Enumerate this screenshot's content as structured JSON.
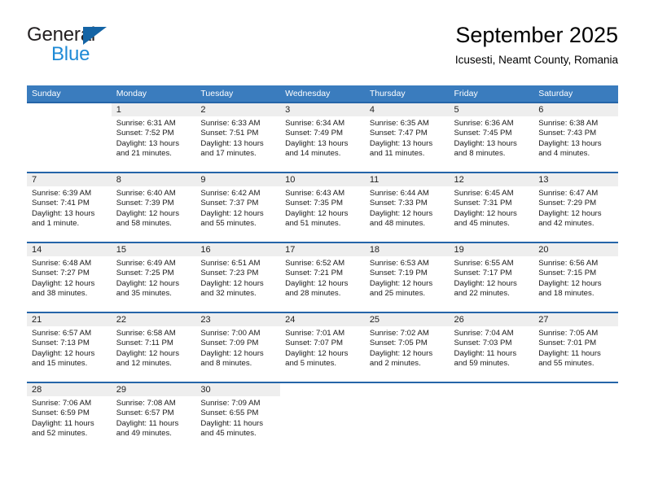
{
  "brand": {
    "line1": "General",
    "line2": "Blue",
    "colors": {
      "dark": "#231f20",
      "blue": "#1e8ad6",
      "triangle": "#1464a5"
    }
  },
  "header": {
    "month_title": "September 2025",
    "location": "Icusesti, Neamt County, Romania"
  },
  "calendar": {
    "header_bg": "#3a7cbe",
    "row_border": "#2565a8",
    "daynum_bg": "#eeeeee",
    "weekdays": [
      "Sunday",
      "Monday",
      "Tuesday",
      "Wednesday",
      "Thursday",
      "Friday",
      "Saturday"
    ],
    "weeks": [
      [
        {
          "day": "",
          "sunrise": "",
          "sunset": "",
          "daylight": "",
          "daylight2": ""
        },
        {
          "day": "1",
          "sunrise": "Sunrise: 6:31 AM",
          "sunset": "Sunset: 7:52 PM",
          "daylight": "Daylight: 13 hours",
          "daylight2": "and 21 minutes."
        },
        {
          "day": "2",
          "sunrise": "Sunrise: 6:33 AM",
          "sunset": "Sunset: 7:51 PM",
          "daylight": "Daylight: 13 hours",
          "daylight2": "and 17 minutes."
        },
        {
          "day": "3",
          "sunrise": "Sunrise: 6:34 AM",
          "sunset": "Sunset: 7:49 PM",
          "daylight": "Daylight: 13 hours",
          "daylight2": "and 14 minutes."
        },
        {
          "day": "4",
          "sunrise": "Sunrise: 6:35 AM",
          "sunset": "Sunset: 7:47 PM",
          "daylight": "Daylight: 13 hours",
          "daylight2": "and 11 minutes."
        },
        {
          "day": "5",
          "sunrise": "Sunrise: 6:36 AM",
          "sunset": "Sunset: 7:45 PM",
          "daylight": "Daylight: 13 hours",
          "daylight2": "and 8 minutes."
        },
        {
          "day": "6",
          "sunrise": "Sunrise: 6:38 AM",
          "sunset": "Sunset: 7:43 PM",
          "daylight": "Daylight: 13 hours",
          "daylight2": "and 4 minutes."
        }
      ],
      [
        {
          "day": "7",
          "sunrise": "Sunrise: 6:39 AM",
          "sunset": "Sunset: 7:41 PM",
          "daylight": "Daylight: 13 hours",
          "daylight2": "and 1 minute."
        },
        {
          "day": "8",
          "sunrise": "Sunrise: 6:40 AM",
          "sunset": "Sunset: 7:39 PM",
          "daylight": "Daylight: 12 hours",
          "daylight2": "and 58 minutes."
        },
        {
          "day": "9",
          "sunrise": "Sunrise: 6:42 AM",
          "sunset": "Sunset: 7:37 PM",
          "daylight": "Daylight: 12 hours",
          "daylight2": "and 55 minutes."
        },
        {
          "day": "10",
          "sunrise": "Sunrise: 6:43 AM",
          "sunset": "Sunset: 7:35 PM",
          "daylight": "Daylight: 12 hours",
          "daylight2": "and 51 minutes."
        },
        {
          "day": "11",
          "sunrise": "Sunrise: 6:44 AM",
          "sunset": "Sunset: 7:33 PM",
          "daylight": "Daylight: 12 hours",
          "daylight2": "and 48 minutes."
        },
        {
          "day": "12",
          "sunrise": "Sunrise: 6:45 AM",
          "sunset": "Sunset: 7:31 PM",
          "daylight": "Daylight: 12 hours",
          "daylight2": "and 45 minutes."
        },
        {
          "day": "13",
          "sunrise": "Sunrise: 6:47 AM",
          "sunset": "Sunset: 7:29 PM",
          "daylight": "Daylight: 12 hours",
          "daylight2": "and 42 minutes."
        }
      ],
      [
        {
          "day": "14",
          "sunrise": "Sunrise: 6:48 AM",
          "sunset": "Sunset: 7:27 PM",
          "daylight": "Daylight: 12 hours",
          "daylight2": "and 38 minutes."
        },
        {
          "day": "15",
          "sunrise": "Sunrise: 6:49 AM",
          "sunset": "Sunset: 7:25 PM",
          "daylight": "Daylight: 12 hours",
          "daylight2": "and 35 minutes."
        },
        {
          "day": "16",
          "sunrise": "Sunrise: 6:51 AM",
          "sunset": "Sunset: 7:23 PM",
          "daylight": "Daylight: 12 hours",
          "daylight2": "and 32 minutes."
        },
        {
          "day": "17",
          "sunrise": "Sunrise: 6:52 AM",
          "sunset": "Sunset: 7:21 PM",
          "daylight": "Daylight: 12 hours",
          "daylight2": "and 28 minutes."
        },
        {
          "day": "18",
          "sunrise": "Sunrise: 6:53 AM",
          "sunset": "Sunset: 7:19 PM",
          "daylight": "Daylight: 12 hours",
          "daylight2": "and 25 minutes."
        },
        {
          "day": "19",
          "sunrise": "Sunrise: 6:55 AM",
          "sunset": "Sunset: 7:17 PM",
          "daylight": "Daylight: 12 hours",
          "daylight2": "and 22 minutes."
        },
        {
          "day": "20",
          "sunrise": "Sunrise: 6:56 AM",
          "sunset": "Sunset: 7:15 PM",
          "daylight": "Daylight: 12 hours",
          "daylight2": "and 18 minutes."
        }
      ],
      [
        {
          "day": "21",
          "sunrise": "Sunrise: 6:57 AM",
          "sunset": "Sunset: 7:13 PM",
          "daylight": "Daylight: 12 hours",
          "daylight2": "and 15 minutes."
        },
        {
          "day": "22",
          "sunrise": "Sunrise: 6:58 AM",
          "sunset": "Sunset: 7:11 PM",
          "daylight": "Daylight: 12 hours",
          "daylight2": "and 12 minutes."
        },
        {
          "day": "23",
          "sunrise": "Sunrise: 7:00 AM",
          "sunset": "Sunset: 7:09 PM",
          "daylight": "Daylight: 12 hours",
          "daylight2": "and 8 minutes."
        },
        {
          "day": "24",
          "sunrise": "Sunrise: 7:01 AM",
          "sunset": "Sunset: 7:07 PM",
          "daylight": "Daylight: 12 hours",
          "daylight2": "and 5 minutes."
        },
        {
          "day": "25",
          "sunrise": "Sunrise: 7:02 AM",
          "sunset": "Sunset: 7:05 PM",
          "daylight": "Daylight: 12 hours",
          "daylight2": "and 2 minutes."
        },
        {
          "day": "26",
          "sunrise": "Sunrise: 7:04 AM",
          "sunset": "Sunset: 7:03 PM",
          "daylight": "Daylight: 11 hours",
          "daylight2": "and 59 minutes."
        },
        {
          "day": "27",
          "sunrise": "Sunrise: 7:05 AM",
          "sunset": "Sunset: 7:01 PM",
          "daylight": "Daylight: 11 hours",
          "daylight2": "and 55 minutes."
        }
      ],
      [
        {
          "day": "28",
          "sunrise": "Sunrise: 7:06 AM",
          "sunset": "Sunset: 6:59 PM",
          "daylight": "Daylight: 11 hours",
          "daylight2": "and 52 minutes."
        },
        {
          "day": "29",
          "sunrise": "Sunrise: 7:08 AM",
          "sunset": "Sunset: 6:57 PM",
          "daylight": "Daylight: 11 hours",
          "daylight2": "and 49 minutes."
        },
        {
          "day": "30",
          "sunrise": "Sunrise: 7:09 AM",
          "sunset": "Sunset: 6:55 PM",
          "daylight": "Daylight: 11 hours",
          "daylight2": "and 45 minutes."
        },
        {
          "day": "",
          "sunrise": "",
          "sunset": "",
          "daylight": "",
          "daylight2": ""
        },
        {
          "day": "",
          "sunrise": "",
          "sunset": "",
          "daylight": "",
          "daylight2": ""
        },
        {
          "day": "",
          "sunrise": "",
          "sunset": "",
          "daylight": "",
          "daylight2": ""
        },
        {
          "day": "",
          "sunrise": "",
          "sunset": "",
          "daylight": "",
          "daylight2": ""
        }
      ]
    ]
  }
}
